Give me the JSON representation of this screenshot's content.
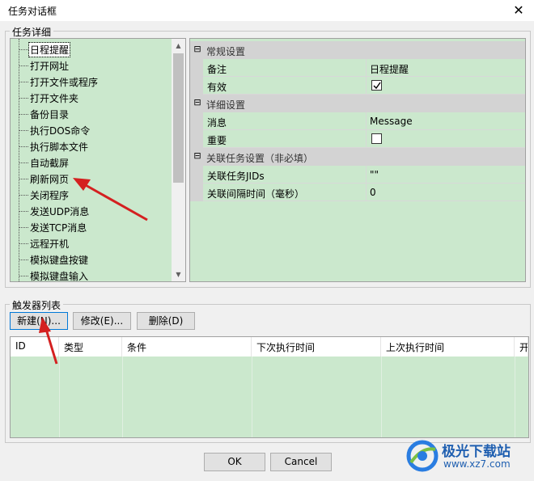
{
  "window": {
    "title": "任务对话框",
    "close_glyph": "✕"
  },
  "task_group": {
    "label": "任务详细",
    "tree_items": [
      "日程提醒",
      "打开网址",
      "打开文件或程序",
      "打开文件夹",
      "备份目录",
      "执行DOS命令",
      "执行脚本文件",
      "自动截屏",
      "刷新网页",
      "关闭程序",
      "发送UDP消息",
      "发送TCP消息",
      "远程开机",
      "模拟键盘按键",
      "模拟键盘输入"
    ],
    "selected_index": 0
  },
  "properties": {
    "categories": [
      {
        "name": "常规设置",
        "rows": [
          {
            "name": "备注",
            "value": "日程提醒"
          },
          {
            "name": "有效",
            "value": "",
            "checked": true
          }
        ]
      },
      {
        "name": "详细设置",
        "rows": [
          {
            "name": "消息",
            "value": "Message"
          },
          {
            "name": "重要",
            "value": "",
            "checked": false
          }
        ]
      },
      {
        "name": "关联任务设置（非必填）",
        "rows": [
          {
            "name": "关联任务JIDs",
            "value": "\"\""
          },
          {
            "name": "关联间隔时间（毫秒）",
            "value": "0"
          }
        ]
      }
    ],
    "expander_glyph": "⊟"
  },
  "trigger_group": {
    "label": "触发器列表",
    "buttons": {
      "new": "新建(N)...",
      "edit": "修改(E)...",
      "delete": "删除(D)"
    },
    "columns": [
      "ID",
      "类型",
      "条件",
      "下次执行时间",
      "上次执行时间",
      "开"
    ]
  },
  "dialog_buttons": {
    "ok": "OK",
    "cancel": "Cancel"
  },
  "watermark": {
    "name": "极光下载站",
    "url": "www.xz7.com"
  },
  "colors": {
    "green": "#cbe8cd",
    "category_bg": "#d3d3d3",
    "arrow": "#d42020",
    "accent": "#0078d7"
  }
}
